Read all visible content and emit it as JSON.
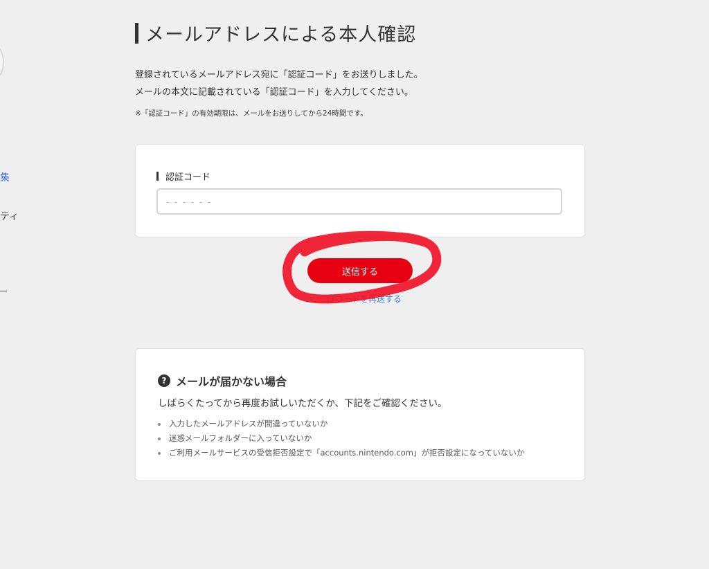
{
  "sidebar": {
    "edit_label": "編集",
    "security_label": "ュリティ"
  },
  "page_title": "メールアドレスによる本人確認",
  "description": {
    "line1": "登録されているメールアドレス宛に「認証コード」をお送りしました。",
    "line2": "メールの本文に記載されている「認証コード」を入力してください。"
  },
  "note": "※「認証コード」の有効期限は、メールをお送りしてから24時間です。",
  "code_form": {
    "label": "認証コード",
    "placeholder": "- - - - - -",
    "value": ""
  },
  "submit_label": "送信する",
  "resend_label": "証コードを再送する",
  "help": {
    "icon": "question-icon",
    "title": "メールが届かない場合",
    "subtitle": "しばらくたってから再度お試しいただくか、下記をご確認ください。",
    "items": [
      "入力したメールアドレスが間違っていないか",
      "迷惑メールフォルダーに入っていないか",
      "ご利用メールサービスの受信拒否設定で「accounts.nintendo.com」が拒否設定になっていないか"
    ]
  },
  "colors": {
    "accent_red": "#e60012",
    "link_blue": "#3f77d1",
    "annotation_red": "#f0152a"
  }
}
